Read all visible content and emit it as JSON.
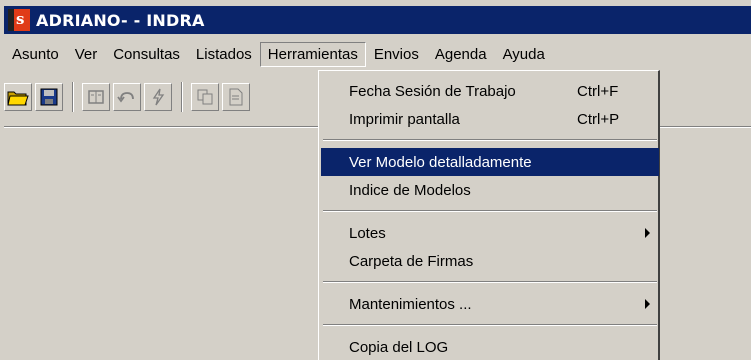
{
  "window": {
    "title": "ADRIANO- - INDRA",
    "app_icon_letter": "s"
  },
  "menubar": {
    "items": [
      "Asunto",
      "Ver",
      "Consultas",
      "Listados",
      "Herramientas",
      "Envios",
      "Agenda",
      "Ayuda"
    ],
    "open_item": "Herramientas"
  },
  "toolbar": {
    "buttons": [
      "open-folder-icon",
      "save-icon",
      "model-icon",
      "undo-icon",
      "lightning-icon",
      "copy-icon",
      "document-icon"
    ]
  },
  "dropdown": {
    "items": [
      {
        "label": "Fecha Sesión de Trabajo",
        "shortcut": "Ctrl+F"
      },
      {
        "label": "Imprimir pantalla",
        "shortcut": "Ctrl+P"
      },
      {
        "label": "Ver Modelo detalladamente",
        "highlighted": true
      },
      {
        "label": "Indice de Modelos"
      },
      {
        "label": "Lotes",
        "submenu": true
      },
      {
        "label": "Carpeta de Firmas"
      },
      {
        "label": "Mantenimientos ...",
        "submenu": true
      },
      {
        "label": "Copia del LOG"
      }
    ]
  },
  "colors": {
    "titlebar": "#0a246a",
    "highlight": "#0a246a",
    "face": "#d4d0c8",
    "app_icon": "#e03b18"
  }
}
